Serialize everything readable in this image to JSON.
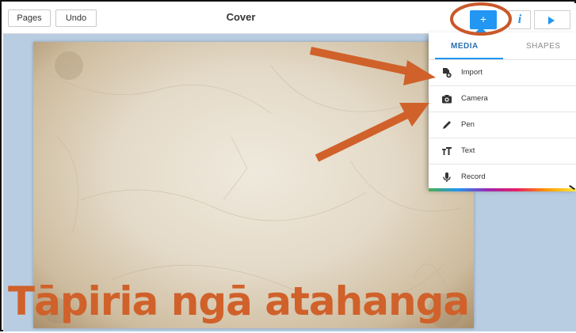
{
  "toolbar": {
    "pages_label": "Pages",
    "undo_label": "Undo",
    "title": "Cover",
    "add_label": "+",
    "info_label": "i"
  },
  "menu": {
    "tabs": [
      {
        "label": "MEDIA",
        "active": true
      },
      {
        "label": "SHAPES",
        "active": false
      }
    ],
    "items": [
      {
        "label": "Import",
        "icon": "import-file-icon"
      },
      {
        "label": "Camera",
        "icon": "camera-icon"
      },
      {
        "label": "Pen",
        "icon": "pen-icon"
      },
      {
        "label": "Text",
        "icon": "text-size-icon"
      },
      {
        "label": "Record",
        "icon": "microphone-icon"
      }
    ]
  },
  "caption": "Tāpiria ngā atahanga",
  "colors": {
    "accent": "#2196f3",
    "annotation": "#d0612a",
    "workspace": "#b9cde2"
  }
}
